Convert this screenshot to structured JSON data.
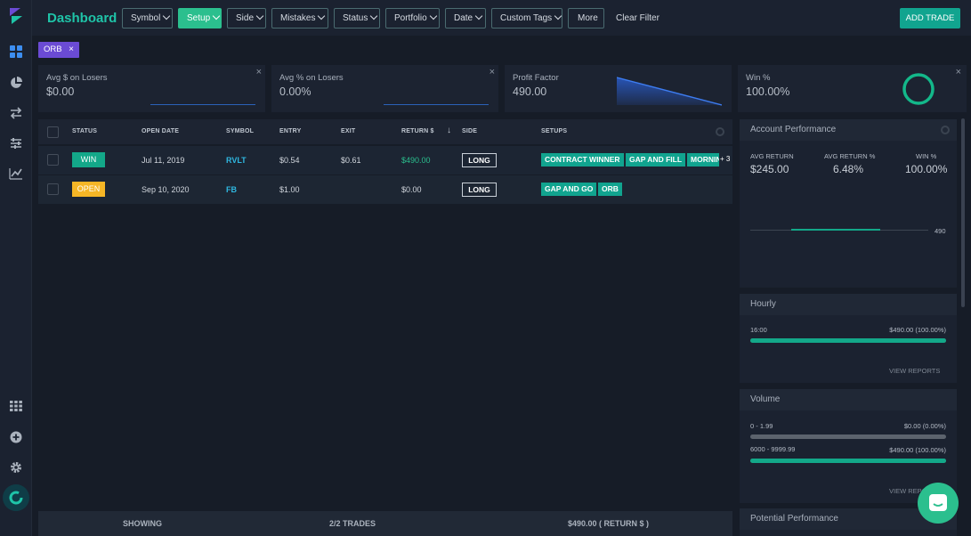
{
  "header": {
    "title": "Dashboard",
    "filters": [
      {
        "label": "Symbol",
        "active": false
      },
      {
        "label": "Setup",
        "active": true
      },
      {
        "label": "Side",
        "active": false
      },
      {
        "label": "Mistakes",
        "active": false
      },
      {
        "label": "Status",
        "active": false
      },
      {
        "label": "Portfolio",
        "active": false
      },
      {
        "label": "Date",
        "active": false
      },
      {
        "label": "Custom Tags",
        "active": false
      }
    ],
    "more_label": "More",
    "clear_label": "Clear Filter",
    "add_trade_label": "ADD TRADE"
  },
  "filter_chip": {
    "label": "ORB",
    "remove": "×"
  },
  "stats": {
    "avg_dollar_losers": {
      "label": "Avg $ on Losers",
      "value": "$0.00"
    },
    "avg_pct_losers": {
      "label": "Avg % on Losers",
      "value": "0.00%"
    },
    "profit_factor": {
      "label": "Profit Factor",
      "value": "490.00"
    },
    "win_pct": {
      "label": "Win %",
      "value": "100.00%"
    },
    "close_symbol": "×"
  },
  "table": {
    "columns": [
      "STATUS",
      "OPEN DATE",
      "SYMBOL",
      "ENTRY",
      "EXIT",
      "RETURN $",
      "SIDE",
      "SETUPS"
    ],
    "sort_indicator": "↓",
    "rows": [
      {
        "status": "WIN",
        "status_color": "#13a889",
        "open_date": "Jul 11, 2019",
        "symbol": "RVLT",
        "entry": "$0.54",
        "exit": "$0.61",
        "return": "$490.00",
        "side": "LONG",
        "setups": [
          "CONTRACT WINNER",
          "GAP AND FILL",
          "MORNIN"
        ],
        "more": "+ 3"
      },
      {
        "status": "OPEN",
        "status_color": "#f6b626",
        "open_date": "Sep 10, 2020",
        "symbol": "FB",
        "entry": "$1.00",
        "exit": "",
        "return": "$0.00",
        "side": "LONG",
        "setups": [
          "GAP AND GO",
          "ORB"
        ],
        "more": ""
      }
    ]
  },
  "footer": {
    "showing": "SHOWING",
    "trades": "2/2 TRADES",
    "total": "$490.00 ( RETURN $ )"
  },
  "account_performance": {
    "title": "Account Performance",
    "avg_return_label": "AVG RETURN",
    "avg_return": "$245.00",
    "avg_return_pct_label": "AVG RETURN %",
    "avg_return_pct": "6.48%",
    "win_label": "WIN %",
    "win": "100.00%",
    "chart_label": "490"
  },
  "hourly": {
    "title": "Hourly",
    "hour": "16:00",
    "value": "$490.00 (100.00%)",
    "fill": 1.0,
    "view_reports": "VIEW REPORTS"
  },
  "volume": {
    "title": "Volume",
    "rows": [
      {
        "range": "0 - 1.99",
        "value": "$0.00 (0.00%)",
        "fill": 0.0
      },
      {
        "range": "6000 - 9999.99",
        "value": "$490.00 (100.00%)",
        "fill": 1.0
      }
    ],
    "view_reports": "VIEW REPO"
  },
  "potential_performance": {
    "title": "Potential Performance"
  },
  "colors": {
    "accent": "#1fc4a8",
    "win": "#13a889",
    "open": "#f6b626",
    "chip": "#6b4bd4"
  }
}
